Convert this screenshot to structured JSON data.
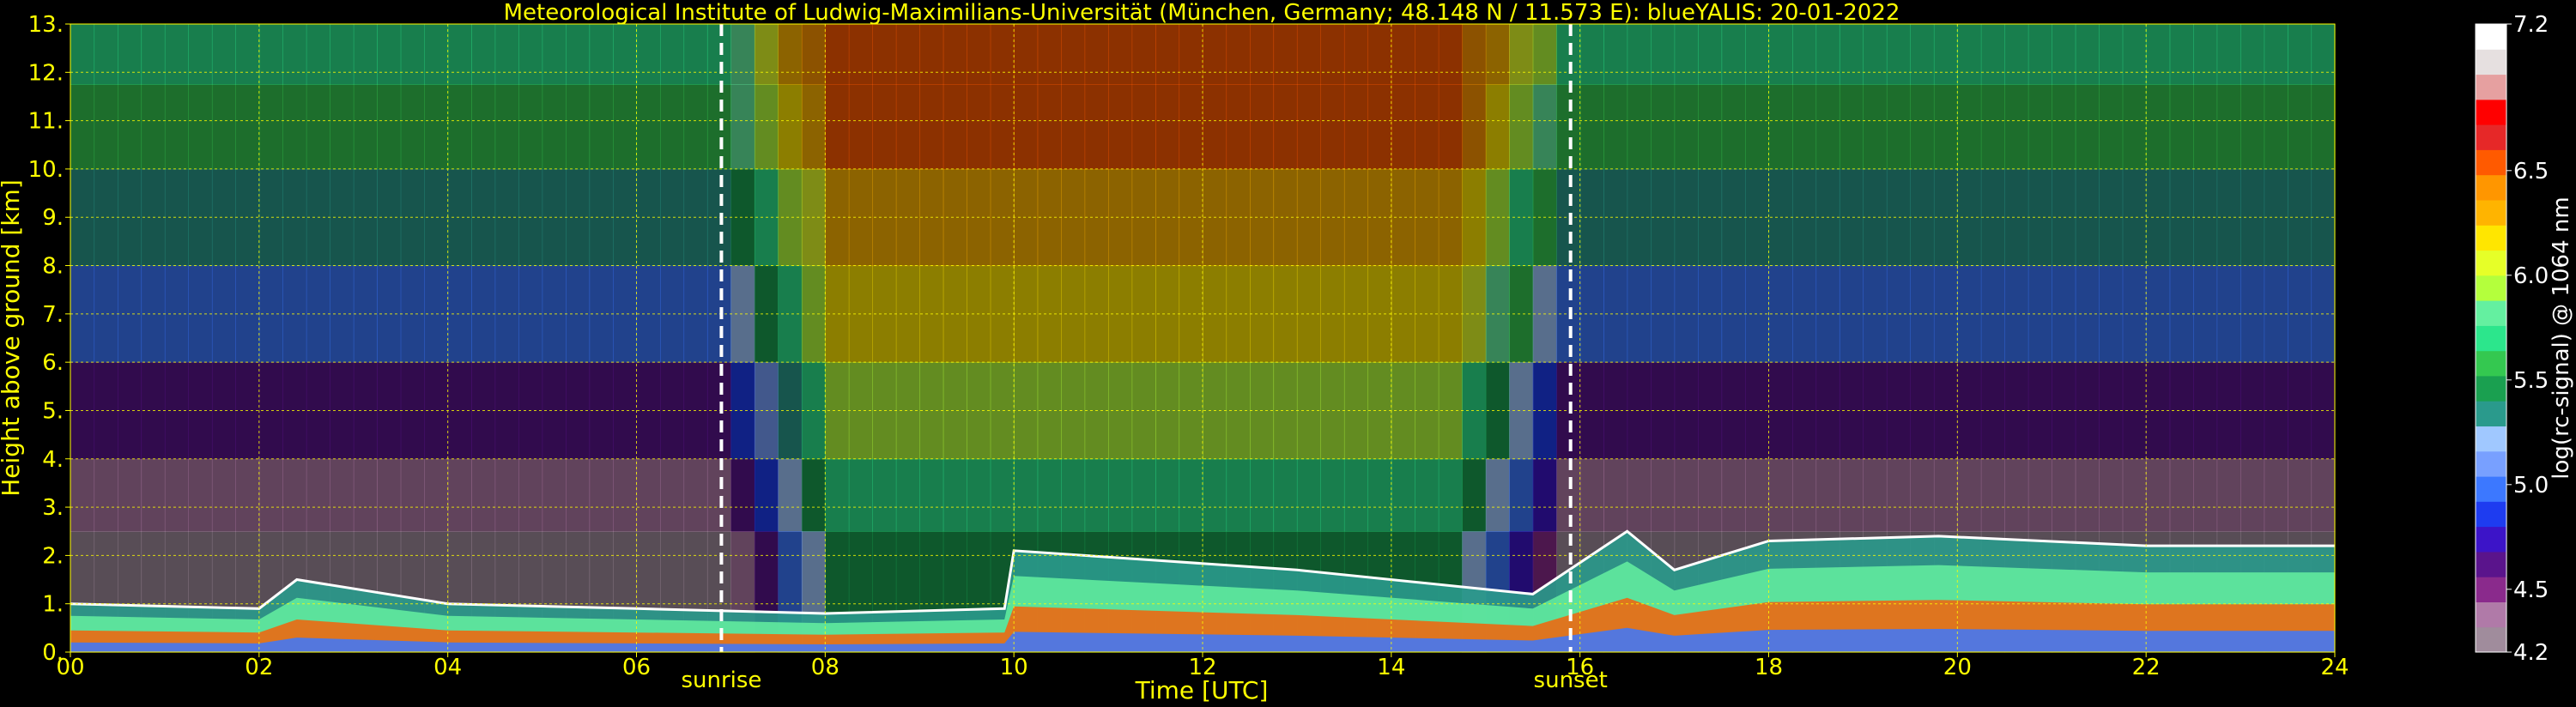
{
  "chart_data": {
    "type": "heatmap",
    "title": "Meteorological Institute of Ludwig-Maximilians-Universität (München, Germany; 48.148 N / 11.573 E):     blueYALIS: 20-01-2022",
    "xlabel": "Time [UTC]",
    "ylabel": "Height above ground [km]",
    "xlim": [
      0,
      24
    ],
    "ylim": [
      0,
      13
    ],
    "x_ticks": [
      0,
      2,
      4,
      6,
      8,
      10,
      12,
      14,
      16,
      18,
      20,
      22,
      24
    ],
    "x_tick_labels": [
      "00",
      "02",
      "04",
      "06",
      "08",
      "10",
      "12",
      "14",
      "16",
      "18",
      "20",
      "22",
      "24"
    ],
    "y_ticks": [
      0,
      1,
      2,
      3,
      4,
      5,
      6,
      7,
      8,
      9,
      10,
      11,
      12,
      13
    ],
    "y_tick_labels": [
      "0.",
      "1.",
      "2.",
      "3.",
      "4.",
      "5.",
      "6.",
      "7.",
      "8.",
      "9.",
      "10.",
      "11.",
      "12.",
      "13."
    ],
    "grid": true,
    "grid_color": "#ffff00",
    "annotations": [
      {
        "label": "sunrise",
        "x": 6.9
      },
      {
        "label": "sunset",
        "x": 15.9
      }
    ],
    "colorbar": {
      "label": "log(rc-signal) @ 1064 nm",
      "range": [
        4.2,
        7.2
      ],
      "tick_values": [
        4.2,
        4.5,
        5.0,
        5.5,
        6.0,
        6.5,
        7.2
      ],
      "tick_labels": [
        "4.2",
        "4.5",
        "5.0",
        "5.5",
        "6.0",
        "6.5",
        "7.2"
      ],
      "colors": [
        "#a08c9c",
        "#b07aa8",
        "#8a2a8c",
        "#5a148c",
        "#3c14c8",
        "#1e3cf0",
        "#3c78ff",
        "#78a0ff",
        "#a0c8ff",
        "#2a9a8c",
        "#1aa050",
        "#34c850",
        "#2ce68c",
        "#64f0a0",
        "#b4ff3c",
        "#e6ff28",
        "#ffe600",
        "#ffb400",
        "#ff9600",
        "#ff5a00",
        "#e62828",
        "#ff0000",
        "#e6a0a0",
        "#e6e0e0",
        "#ffffff"
      ]
    },
    "layers": {
      "noise_rows": [
        {
          "h_km": 12.5,
          "base_level": 5.7,
          "day_level": 6.6
        },
        {
          "h_km": 11,
          "base_level": 5.6,
          "day_level": 6.5
        },
        {
          "h_km": 9,
          "base_level": 5.3,
          "day_level": 6.3
        },
        {
          "h_km": 7,
          "base_level": 5.0,
          "day_level": 6.2
        },
        {
          "h_km": 5,
          "base_level": 4.6,
          "day_level": 5.9
        },
        {
          "h_km": 3,
          "base_level": 4.4,
          "day_level": 5.7
        },
        {
          "h_km": 2,
          "base_level": 4.2,
          "day_level": 5.4
        }
      ],
      "boundary_layer_top_km": [
        {
          "t": 0,
          "h": 1.0
        },
        {
          "t": 2,
          "h": 0.9
        },
        {
          "t": 2.4,
          "h": 1.5
        },
        {
          "t": 4,
          "h": 1.0
        },
        {
          "t": 6,
          "h": 0.9
        },
        {
          "t": 8,
          "h": 0.8
        },
        {
          "t": 9.9,
          "h": 0.9
        },
        {
          "t": 10,
          "h": 2.1
        },
        {
          "t": 11.5,
          "h": 1.9
        },
        {
          "t": 13,
          "h": 1.7
        },
        {
          "t": 15.5,
          "h": 1.2
        },
        {
          "t": 16.5,
          "h": 2.5
        },
        {
          "t": 17,
          "h": 1.7
        },
        {
          "t": 18,
          "h": 2.3
        },
        {
          "t": 19.8,
          "h": 2.4
        },
        {
          "t": 22,
          "h": 2.2
        },
        {
          "t": 24,
          "h": 2.2
        }
      ]
    }
  }
}
